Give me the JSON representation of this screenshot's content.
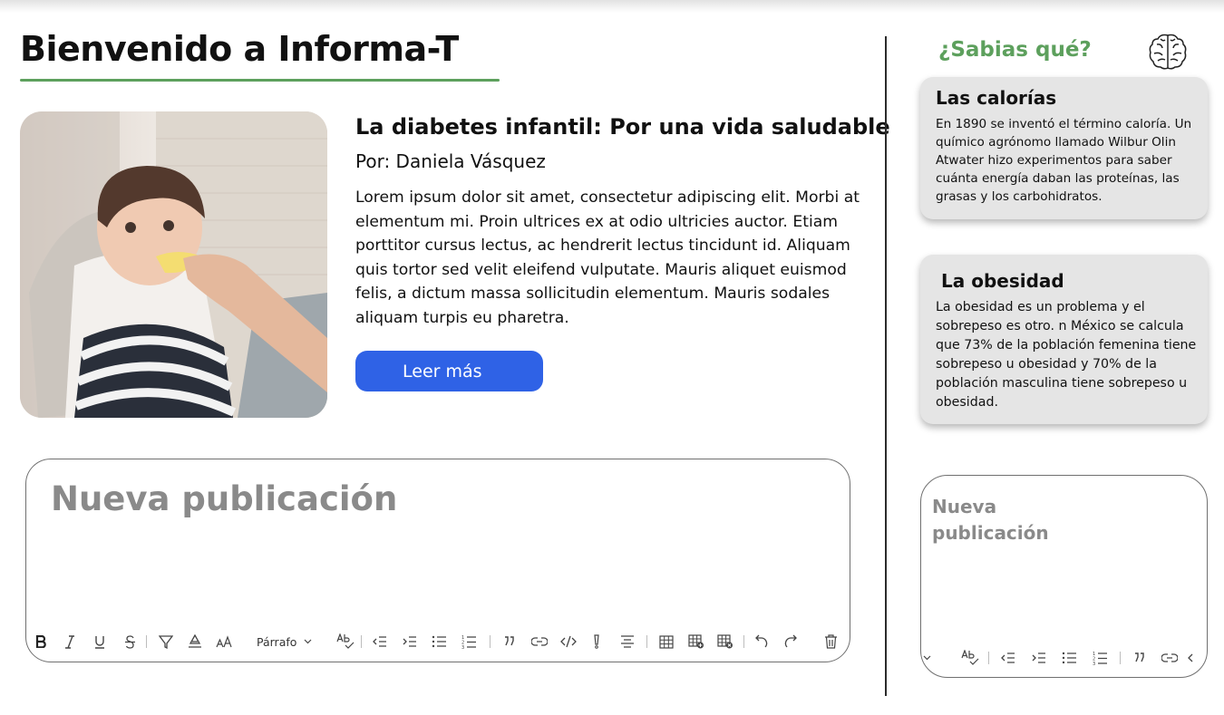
{
  "header": {
    "title": "Bienvenido a Informa-T"
  },
  "article": {
    "title": "La diabetes infantil: Por una vida saludable",
    "author": "Por: Daniela Vásquez",
    "body": "Lorem ipsum dolor sit amet, consectetur adipiscing elit. Morbi at elementum mi. Proin ultrices ex at odio ultricies auctor. Etiam porttitor cursus lectus, ac hendrerit lectus tincidunt id. Aliquam quis tortor sed velit eleifend vulputate. Mauris aliquet euismod felis, a dictum massa sollicitudin elementum. Mauris sodales aliquam turpis eu pharetra.",
    "read_more_label": "Leer más"
  },
  "editor_main": {
    "placeholder": "Nueva publicación",
    "paragraph_select": "Párrafo"
  },
  "sidebar": {
    "heading": "¿Sabias qué?",
    "cards": [
      {
        "title": "Las calorías",
        "text": "En 1890 se inventó el término caloría. Un químico agrónomo llamado Wilbur Olin Atwater hizo experimentos para saber cuánta energía daban las proteínas, las grasas y los carbohidratos."
      },
      {
        "title": "La obesidad",
        "text": "La obesidad es un problema y el sobrepeso es otro. n México se calcula que 73% de la población femenina tiene sobrepeso u obesidad y 70% de la población masculina tiene sobrepeso u obesidad."
      }
    ]
  },
  "editor_side": {
    "placeholder": "Nueva publicación"
  },
  "colors": {
    "accent_green": "#5da05d",
    "button_blue": "#2f62e6",
    "card_bg": "#e5e5e5",
    "placeholder_gray": "#8a8a8a"
  },
  "icons": [
    "bold-icon",
    "italic-icon",
    "underline-icon",
    "strikethrough-icon",
    "highlight-icon",
    "font-color-icon",
    "font-size-icon",
    "spellcheck-icon",
    "outdent-icon",
    "indent-icon",
    "bullet-list-icon",
    "numbered-list-icon",
    "quote-icon",
    "link-icon",
    "code-icon",
    "alert-icon",
    "align-center-icon",
    "table-icon",
    "table-add-icon",
    "table-delete-icon",
    "undo-icon",
    "redo-icon",
    "trash-icon",
    "brain-icon"
  ]
}
